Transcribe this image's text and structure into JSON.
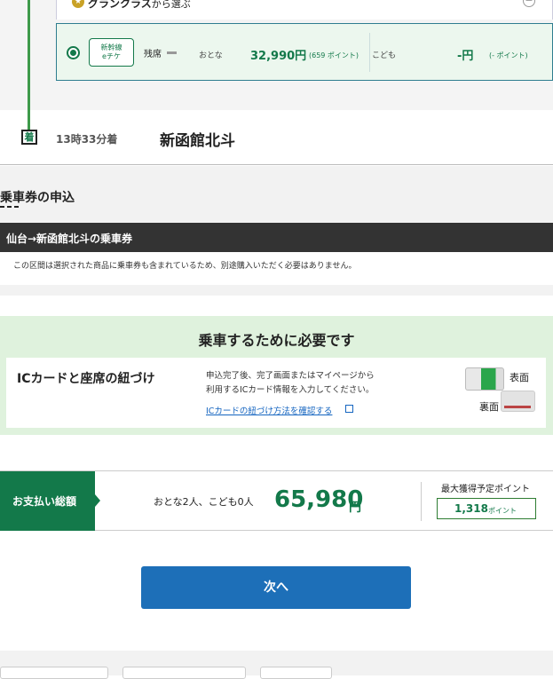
{
  "fare_selection": {
    "green_class_label": "グランクラス",
    "green_class_suffix": "から選ぶ",
    "eticket_line1": "新幹線",
    "eticket_line2": "eチケ",
    "seats_left_label": "残席",
    "adult_label": "おとな",
    "adult_price": "32,990円",
    "adult_points": "(659 ポイント)",
    "child_label": "こども",
    "child_price": "-円",
    "child_points": "(- ポイント)"
  },
  "arrival": {
    "badge": "着",
    "time": "13時33分着",
    "station": "新函館北斗"
  },
  "ticket": {
    "section_title": "乗車券の申込",
    "bar_title": "仙台→新函館北斗の乗車券",
    "note": "この区間は選択された商品に乗車券も含まれているため、別途購入いただく必要はありません。"
  },
  "requirement": {
    "heading": "乗車するために必要です",
    "card_title": "ICカードと座席の紐づけ",
    "desc_line1": "申込完了後、完了画面またはマイページから",
    "desc_line2": "利用するICカード情報を入力してください。",
    "link_text": "ICカードの紐づけ方法を確認する",
    "front_label": "表面",
    "back_label": "裏面"
  },
  "payment": {
    "tag": "お支払い総額",
    "people": "おとな2人、こども0人",
    "amount": "65,980",
    "yen": "円",
    "points_title": "最大獲得予定ポイント",
    "points_value": "1,318",
    "points_unit": "ポイント"
  },
  "actions": {
    "next_label": "次へ"
  },
  "colors": {
    "brand_green": "#13794a",
    "route_green": "#3e9a4a",
    "link_blue": "#1565c0",
    "button_blue": "#1d6fb8"
  }
}
